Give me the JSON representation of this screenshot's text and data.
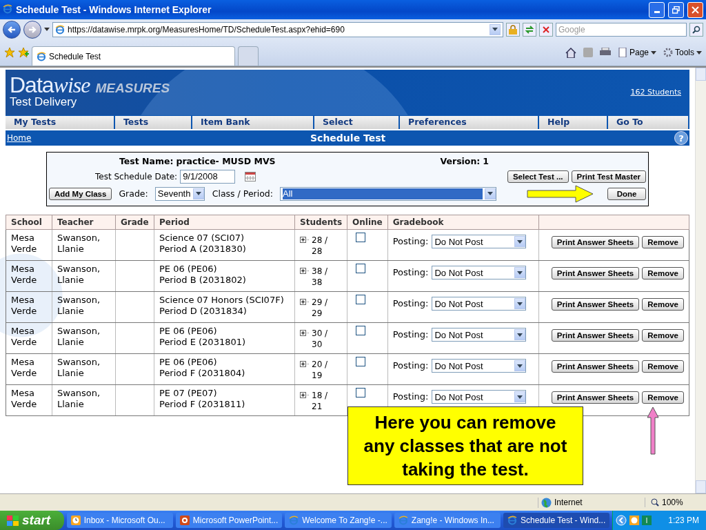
{
  "window": {
    "title": "Schedule Test - Windows Internet Explorer"
  },
  "address_bar": {
    "url": "https://datawise.mrpk.org/MeasuresHome/TD/ScheduleTest.aspx?ehid=690",
    "search_placeholder": "Google"
  },
  "tabs": [
    {
      "label": "Schedule Test",
      "selected": true
    }
  ],
  "command_bar": [
    "Page",
    "Tools"
  ],
  "banner": {
    "logo": "Data",
    "logo_accent": "wise",
    "product": "MEASURES",
    "subtitle": "Test Delivery",
    "students_link": "162 Students"
  },
  "nav": [
    "My Tests",
    "Tests",
    "Item Bank",
    "Select",
    "Preferences",
    "Help",
    "Go To"
  ],
  "subheader": {
    "home_link": "Home",
    "title": "Schedule Test",
    "help": "?"
  },
  "form": {
    "test_name_label": "Test Name:",
    "test_name": "practice- MUSD MVS",
    "version_label": "Version:",
    "version": "1",
    "date_label": "Test Schedule Date:",
    "date": "9/1/2008",
    "select_test": "Select Test ...",
    "print_master": "Print Test Master",
    "add_class": "Add My Class",
    "grade_label": "Grade:",
    "grade": "Seventh",
    "class_label": "Class / Period:",
    "class_value": "All",
    "done": "Done"
  },
  "table": {
    "columns": [
      "School",
      "Teacher",
      "Grade",
      "Period",
      "Students",
      "Online",
      "Gradebook"
    ],
    "rows": [
      {
        "school": "Mesa Verde",
        "teacher": "Swanson, Llanie",
        "course": "Science 07 (SCI07)",
        "period": "Period A (2031830)",
        "students": "28 / 28",
        "online": false,
        "posting_label": "Posting:",
        "posting": "Do Not Post",
        "print": "Print Answer Sheets",
        "remove": "Remove"
      },
      {
        "school": "Mesa Verde",
        "teacher": "Swanson, Llanie",
        "course": "PE 06 (PE06)",
        "period": "Period B (2031802)",
        "students": "38 / 38",
        "online": false,
        "posting_label": "Posting:",
        "posting": "Do Not Post",
        "print": "Print Answer Sheets",
        "remove": "Remove"
      },
      {
        "school": "Mesa Verde",
        "teacher": "Swanson, Llanie",
        "course": "Science 07 Honors (SCI07F)",
        "period": "Period D (2031834)",
        "students": "29 / 29",
        "online": false,
        "posting_label": "Posting:",
        "posting": "Do Not Post",
        "print": "Print Answer Sheets",
        "remove": "Remove"
      },
      {
        "school": "Mesa Verde",
        "teacher": "Swanson, Llanie",
        "course": "PE 06 (PE06)",
        "period": "Period E (2031801)",
        "students": "30 / 30",
        "online": false,
        "posting_label": "Posting:",
        "posting": "Do Not Post",
        "print": "Print Answer Sheets",
        "remove": "Remove"
      },
      {
        "school": "Mesa Verde",
        "teacher": "Swanson, Llanie",
        "course": "PE 06 (PE06)",
        "period": "Period F (2031804)",
        "students": "20 / 19",
        "online": false,
        "posting_label": "Posting:",
        "posting": "Do Not Post",
        "print": "Print Answer Sheets",
        "remove": "Remove"
      },
      {
        "school": "Mesa Verde",
        "teacher": "Swanson, Llanie",
        "course": "PE 07 (PE07)",
        "period": "Period F (2031811)",
        "students": "18 / 21",
        "online": false,
        "posting_label": "Posting:",
        "posting": "Do Not Post",
        "print": "Print Answer Sheets",
        "remove": "Remove"
      }
    ]
  },
  "callout": {
    "text": "Here you can remove any classes that are not taking the test."
  },
  "status_bar": {
    "zone": "Internet",
    "zoom": "100%"
  },
  "taskbar": {
    "start": "start",
    "clock": "1:23 PM",
    "items": [
      {
        "label": "Inbox - Microsoft Ou...",
        "kind": "outlook",
        "selected": false
      },
      {
        "label": "Microsoft PowerPoint...",
        "kind": "powerpoint",
        "selected": false
      },
      {
        "label": "Welcome To Zang!e -...",
        "kind": "ie",
        "selected": false
      },
      {
        "label": "Zang!e - Windows In...",
        "kind": "ie",
        "selected": false
      },
      {
        "label": "Schedule Test - Wind...",
        "kind": "ie",
        "selected": true
      }
    ]
  }
}
